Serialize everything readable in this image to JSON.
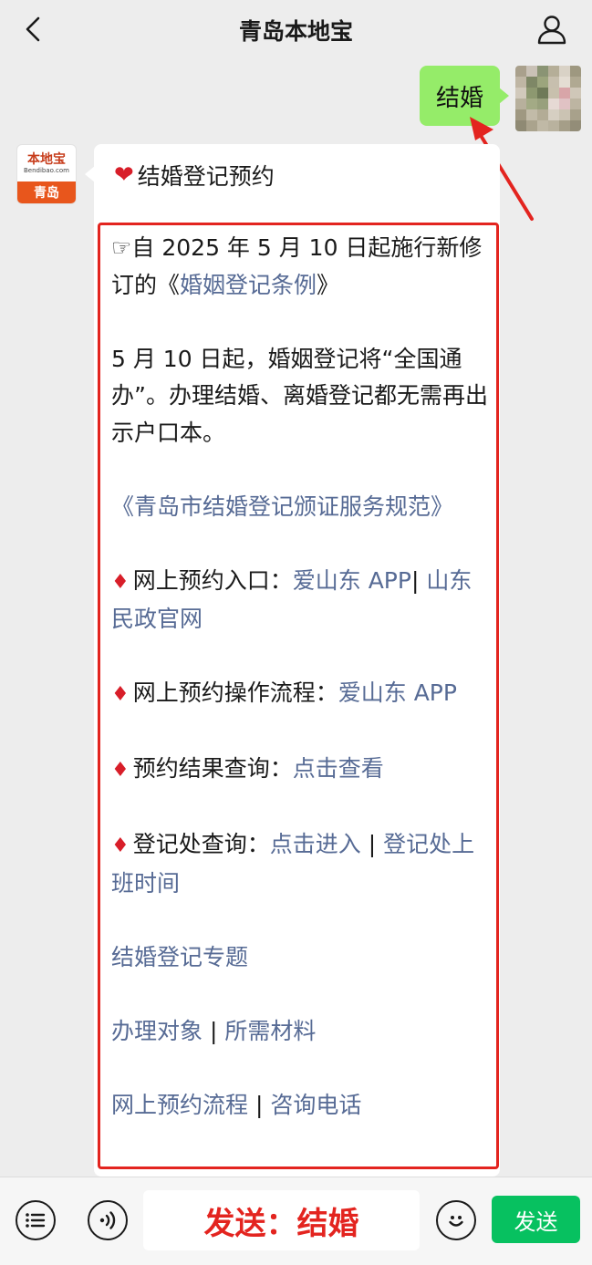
{
  "header": {
    "title": "青岛本地宝"
  },
  "outgoing": {
    "text": "结婚"
  },
  "bot_avatar": {
    "logo_text": "本地宝",
    "logo_sub": "Bendibao.com",
    "city": "青岛"
  },
  "message": {
    "title": "结婚登记预约",
    "blocks": [
      {
        "prefix": "☞自 2025 年 5 月 10 日起施行新修订的《",
        "link": "婚姻登记条例",
        "suffix": "》"
      },
      {
        "text": "5 月 10 日起，婚姻登记将“全国通办”。办理结婚、离婚登记都无需再出示户口本。"
      },
      {
        "link": "《青岛市结婚登记颁证服务规范》"
      },
      {
        "label": "网上预约入口：",
        "link1": "爱山东 APP",
        "sep": "| ",
        "link2": "山东民政官网"
      },
      {
        "label": "网上预约操作流程：",
        "link1": "爱山东 APP"
      },
      {
        "label": "预约结果查询：",
        "link1": "点击查看"
      },
      {
        "label": "登记处查询：",
        "link1": "点击进入",
        "sep": " | ",
        "link2": "登记处上班时间"
      },
      {
        "link": "结婚登记专题"
      },
      {
        "link1": "办理对象",
        "sep": " | ",
        "link2": "所需材料"
      },
      {
        "link1": "网上预约流程",
        "sep": " | ",
        "link2": "咨询电话"
      }
    ]
  },
  "input": {
    "annotation": "发送：结婚"
  },
  "send_button": "发送",
  "colors": {
    "link": "#576b95",
    "accent_red": "#e3241f",
    "bubble_green": "#95ec69",
    "send_green": "#07c160"
  },
  "icons": {
    "back": "chevron-left-icon",
    "profile": "person-icon",
    "keyboard": "keyboard-icon",
    "voice": "voice-icon",
    "emoji": "emoji-icon",
    "heart": "heart-icon",
    "diamond": "diamond-icon"
  }
}
